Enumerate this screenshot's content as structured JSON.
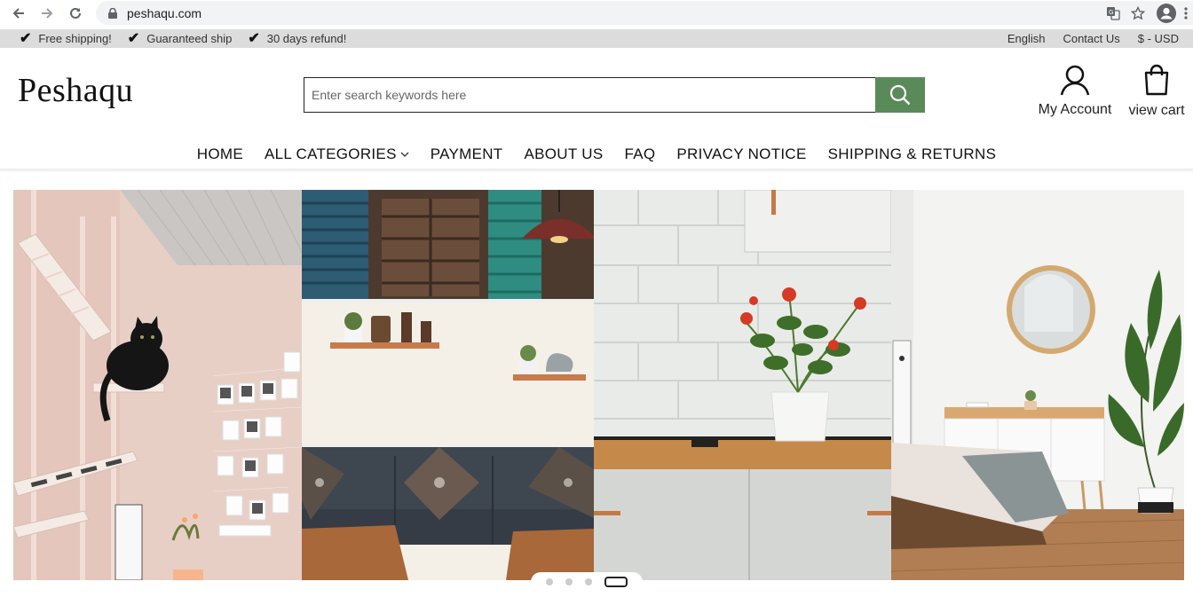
{
  "browser": {
    "url": "peshaqu.com",
    "icons": [
      "back-arrow-icon",
      "forward-arrow-icon",
      "reload-icon",
      "lock-icon",
      "translate-icon",
      "star-icon",
      "profile-icon"
    ]
  },
  "infobar": {
    "perks": [
      "Free shipping!",
      "Guaranteed ship",
      "30 days refund!"
    ],
    "language": "English",
    "contact": "Contact Us",
    "currency": "$ - USD"
  },
  "header": {
    "logo": "Peshaqu",
    "search_placeholder": "Enter search keywords here",
    "account_label": "My Account",
    "cart_label": "view cart",
    "accent": "#5a8a5a"
  },
  "nav": {
    "items": [
      "HOME",
      "ALL CATEGORIES",
      "PAYMENT",
      "ABOUT US",
      "FAQ",
      "PRIVACY NOTICE",
      "SHIPPING & RETURNS"
    ]
  },
  "hero": {
    "slide_count": 4,
    "active_slide": 4
  }
}
